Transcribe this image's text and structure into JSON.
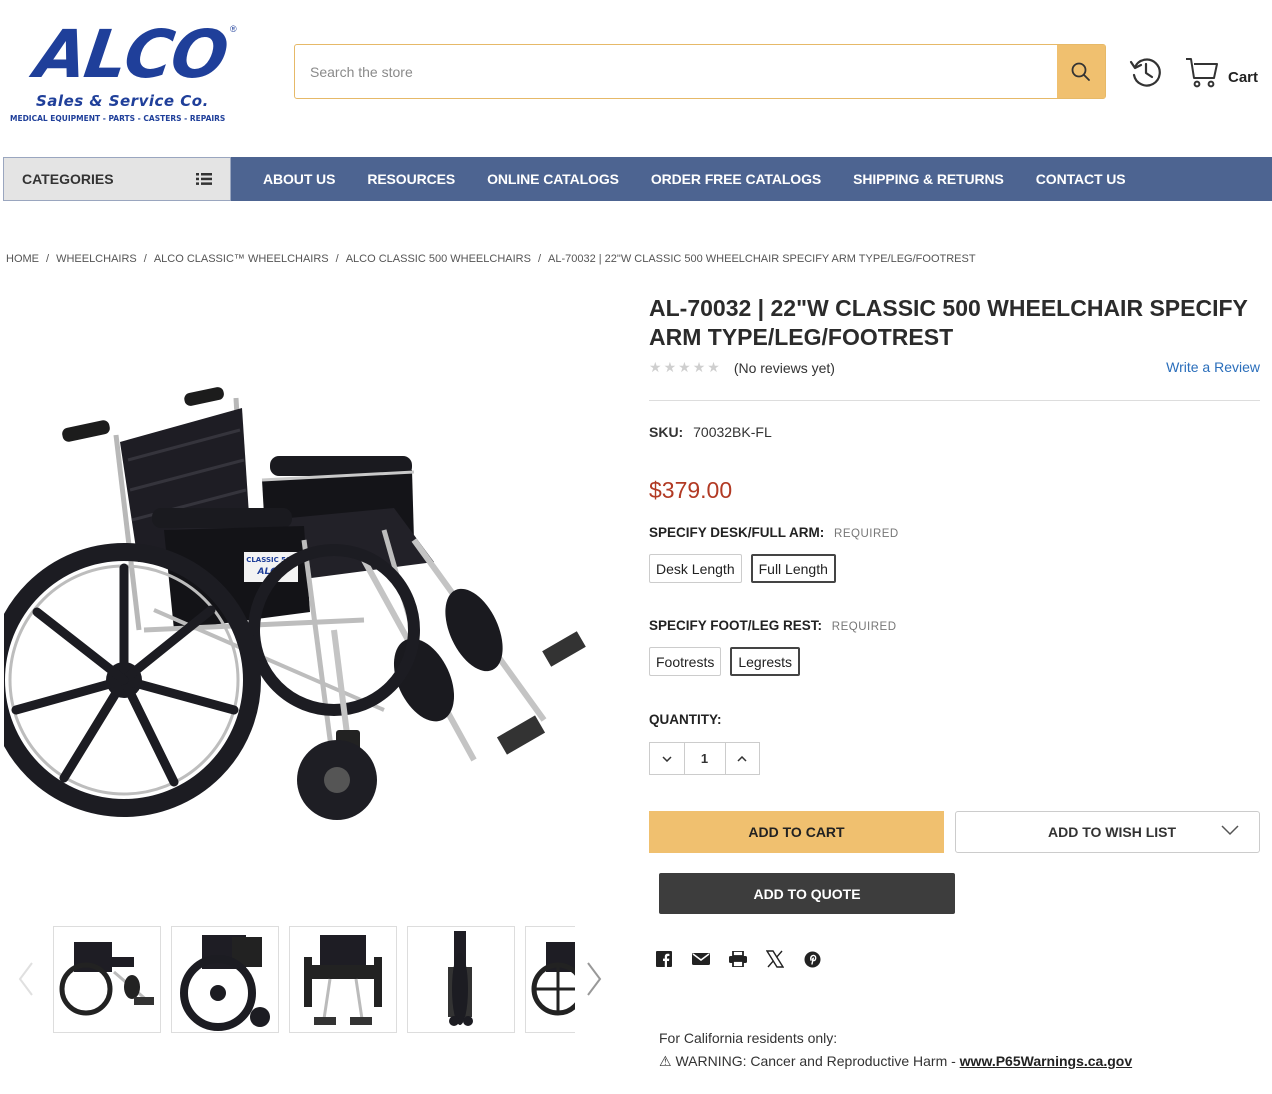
{
  "brand": {
    "name": "ALCO",
    "reg_mark": "®",
    "subtitle": "Sales & Service Co.",
    "tagline": "MEDICAL EQUIPMENT - PARTS - CASTERS - REPAIRS",
    "color": "#1f3f9a"
  },
  "header": {
    "search_placeholder": "Search the store",
    "cart_label": "Cart"
  },
  "nav": {
    "categories_label": "CATEGORIES",
    "links": [
      "ABOUT US",
      "RESOURCES",
      "ONLINE CATALOGS",
      "ORDER FREE CATALOGS",
      "SHIPPING & RETURNS",
      "CONTACT US"
    ],
    "bar_color": "#4d6491"
  },
  "breadcrumb": [
    "HOME",
    "WHEELCHAIRS",
    "ALCO CLASSIC™ WHEELCHAIRS",
    "ALCO CLASSIC 500 WHEELCHAIRS",
    "AL-70032 | 22\"W CLASSIC 500 WHEELCHAIR SPECIFY ARM TYPE/LEG/FOOTREST"
  ],
  "product": {
    "title": "AL-70032 | 22\"W CLASSIC 500 WHEELCHAIR SPECIFY ARM TYPE/LEG/FOOTREST",
    "reviews_text": "(No reviews yet)",
    "write_review": "Write a Review",
    "rating_stars": 0,
    "sku_label": "SKU:",
    "sku": "70032BK-FL",
    "price": "$379.00",
    "price_color": "#b23a24",
    "option1": {
      "label": "SPECIFY DESK/FULL ARM:",
      "required": "REQUIRED",
      "choices": [
        "Desk Length",
        "Full Length"
      ],
      "selected": "Full Length"
    },
    "option2": {
      "label": "SPECIFY FOOT/LEG REST:",
      "required": "REQUIRED",
      "choices": [
        "Footrests",
        "Legrests"
      ],
      "selected": "Legrests"
    },
    "quantity_label": "QUANTITY:",
    "quantity": "1",
    "add_to_cart": "ADD TO CART",
    "add_to_wishlist": "ADD TO WISH LIST",
    "add_to_quote": "ADD TO QUOTE",
    "image_badge": "CLASSIC 500",
    "image_badge_brand": "ALCO"
  },
  "share_icons": [
    "facebook-icon",
    "email-icon",
    "print-icon",
    "x-icon",
    "pinterest-icon"
  ],
  "prop65": {
    "line1": "For California residents only:",
    "warning": "⚠ WARNING: Cancer and Reproductive Harm - ",
    "link": "www.P65Warnings.ca.gov"
  },
  "colors": {
    "accent": "#f0c06f",
    "dark_button": "#3d3d3d",
    "link": "#2a6ebb"
  }
}
